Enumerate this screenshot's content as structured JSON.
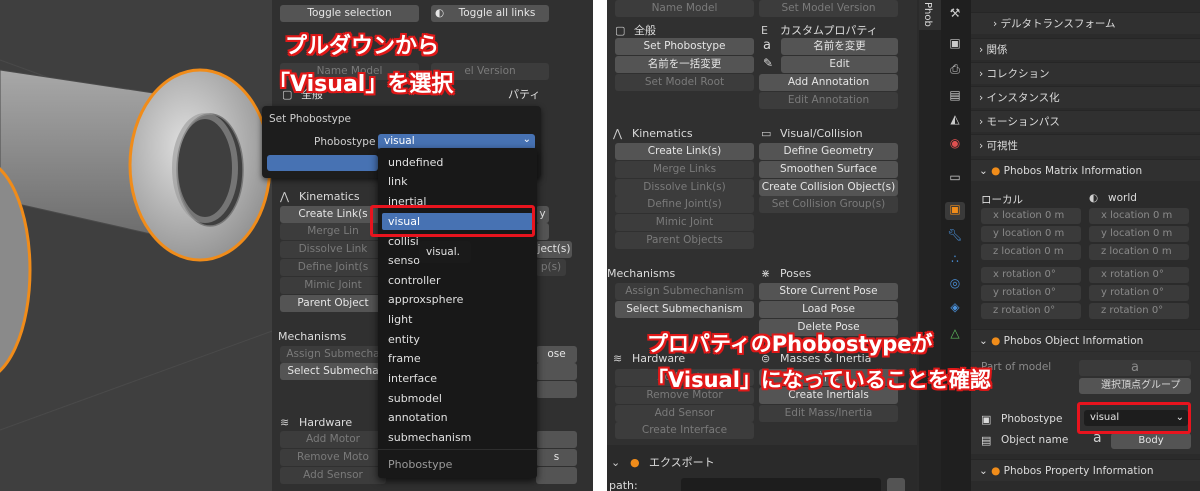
{
  "left": {
    "top_buttons": {
      "toggle_selection": "Toggle selection",
      "toggle_all_links": "Toggle all links"
    },
    "behind_buttons": {
      "name_model": "Name Model",
      "set_model_version": "el Version",
      "general": "全般",
      "custom_props": "パティ"
    },
    "popup": {
      "title": "Set Phobostype",
      "field_label": "Phobostype",
      "field_value": "visual",
      "options": [
        "undefined",
        "link",
        "inertial",
        "visual",
        "collisi",
        "senso",
        "controller",
        "approxsphere",
        "light",
        "entity",
        "frame",
        "interface",
        "submodel",
        "annotation",
        "submechanism"
      ],
      "selected_option": "visual",
      "tooltip": "visual.",
      "footer": "Phobostype"
    },
    "kinematics": {
      "header": "Kinematics",
      "buttons": [
        "Create Link(s",
        "Merge Lin",
        "Dissolve Link",
        "Define Joint(s",
        "Mimic Joint",
        "Parent Object"
      ]
    },
    "kin_right": [
      "y",
      "",
      "ject(s)",
      "p(s)"
    ],
    "mechanisms": {
      "header": "Mechanisms",
      "buttons": [
        "Assign Submecha",
        "Select Submecha"
      ],
      "right": "ose"
    },
    "hardware": {
      "header": "Hardware",
      "buttons": [
        "Add Motor",
        "Remove Moto",
        "Add Sensor"
      ],
      "right": "s"
    },
    "annotation_line1": "プルダウンから",
    "annotation_line2": "「Visual」を選択"
  },
  "right": {
    "tab_label": "Phob",
    "name_model": "Name Model",
    "set_model_version": "Set Model Version",
    "general": {
      "header": "全般",
      "buttons": [
        "Set Phobostype",
        "名前を一括変更",
        "Set Model Root"
      ]
    },
    "custom_props": {
      "header": "カスタムプロパティ",
      "buttons": [
        "名前を変更",
        "Edit",
        "Add Annotation",
        "Edit Annotation"
      ]
    },
    "kinematics": {
      "header": "Kinematics",
      "buttons": [
        "Create Link(s)",
        "Merge Links",
        "Dissolve Link(s)",
        "Define Joint(s)",
        "Mimic Joint",
        "Parent Objects"
      ]
    },
    "visual_collision": {
      "header": "Visual/Collision",
      "buttons": [
        "Define Geometry",
        "Smoothen Surface",
        "Create Collision Object(s)",
        "Set Collision Group(s)"
      ]
    },
    "mechanisms": {
      "header": "Mechanisms",
      "buttons": [
        "Assign Submechanism",
        "Select Submechanism"
      ]
    },
    "poses": {
      "header": "Poses",
      "buttons": [
        "Store Current Pose",
        "Load Pose",
        "Delete Pose"
      ]
    },
    "hardware": {
      "header": "Hardware",
      "buttons": [
        "Add Motor",
        "Remove Motor",
        "Add Sensor",
        "Create Interface"
      ]
    },
    "masses": {
      "header": "Masses & Inertia",
      "buttons": [
        "計算",
        "Create Inertials",
        "Edit Mass/Inertia"
      ]
    },
    "export": {
      "header": "エクスポート",
      "path_label": "path:"
    },
    "props": {
      "delta_transform": "デルタトランスフォーム",
      "relations": "関係",
      "collection": "コレクション",
      "instancing": "インスタンス化",
      "motion_path": "モーションパス",
      "visibility": "可視性",
      "matrix_header": "Phobos Matrix Information",
      "local": "ローカル",
      "world": "world",
      "local_loc": [
        "x location  0 m",
        "y location  0 m",
        "z location  0 m"
      ],
      "world_loc": [
        "x location  0 m",
        "y location  0 m",
        "z location  0 m"
      ],
      "local_rot": [
        "x rotation  0°",
        "y rotation  0°",
        "z rotation  0°"
      ],
      "world_rot": [
        "x rotation  0°",
        "y rotation  0°",
        "z rotation  0°"
      ],
      "object_header": "Phobos Object Information",
      "part_of_model": "Part of model",
      "vertex_group": "選択頂点グループ",
      "phobostype_label": "Phobostype",
      "phobostype_value": "visual",
      "object_name_label": "Object name",
      "object_name_value": "Body",
      "property_header": "Phobos Property Information"
    },
    "annotation_line1": "プロパティのPhobostypeが",
    "annotation_line2": "「Visual」になっていることを確認"
  },
  "colors": {
    "accent": "#4772b3",
    "highlight": "#e8141e",
    "selection_orange": "#f08c1a"
  }
}
